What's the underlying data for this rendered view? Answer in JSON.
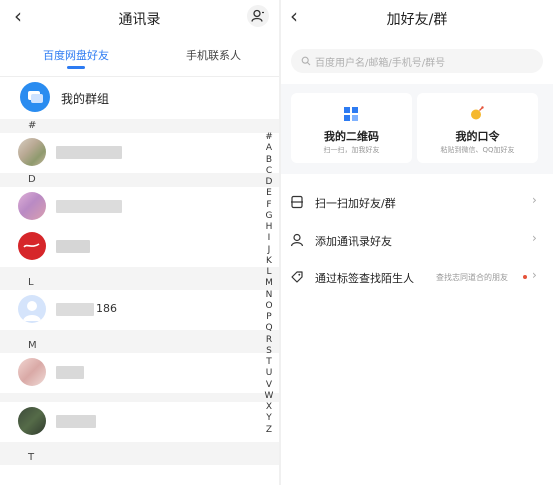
{
  "left": {
    "title": "通讯录",
    "tabs": [
      {
        "label": "百度网盘好友",
        "active": true
      },
      {
        "label": "手机联系人",
        "active": false
      }
    ],
    "my_groups_label": "我的群组",
    "sections": [
      {
        "letter": "#"
      },
      {
        "letter": "D"
      },
      {
        "letter": "L"
      },
      {
        "letter": "M"
      },
      {
        "letter": "T"
      }
    ],
    "visible_name_suffix": "186",
    "index_letters": [
      "#",
      "A",
      "B",
      "C",
      "D",
      "E",
      "F",
      "G",
      "H",
      "I",
      "J",
      "K",
      "L",
      "M",
      "N",
      "O",
      "P",
      "Q",
      "R",
      "S",
      "T",
      "U",
      "V",
      "W",
      "X",
      "Y",
      "Z"
    ],
    "icons": {
      "back": "back-arrow-icon",
      "person": "person-icon",
      "group": "chat-group-icon"
    }
  },
  "right": {
    "title": "加好友/群",
    "search_placeholder": "百度用户名/邮箱/手机号/群号",
    "cards": [
      {
        "title": "我的二维码",
        "subtitle": "扫一扫，加我好友",
        "icon": "qr-code-icon"
      },
      {
        "title": "我的口令",
        "subtitle": "粘贴到微信、QQ加好友",
        "icon": "bomb-icon"
      }
    ],
    "options": [
      {
        "label": "扫一扫加好友/群",
        "icon": "scan-icon"
      },
      {
        "label": "添加通讯录好友",
        "icon": "person-add-icon"
      },
      {
        "label": "通过标签查找陌生人",
        "icon": "tag-icon",
        "hint": "查找志同道合的朋友"
      }
    ]
  },
  "colors": {
    "accent": "#2d7bf2",
    "badge_red": "#e5533a"
  }
}
